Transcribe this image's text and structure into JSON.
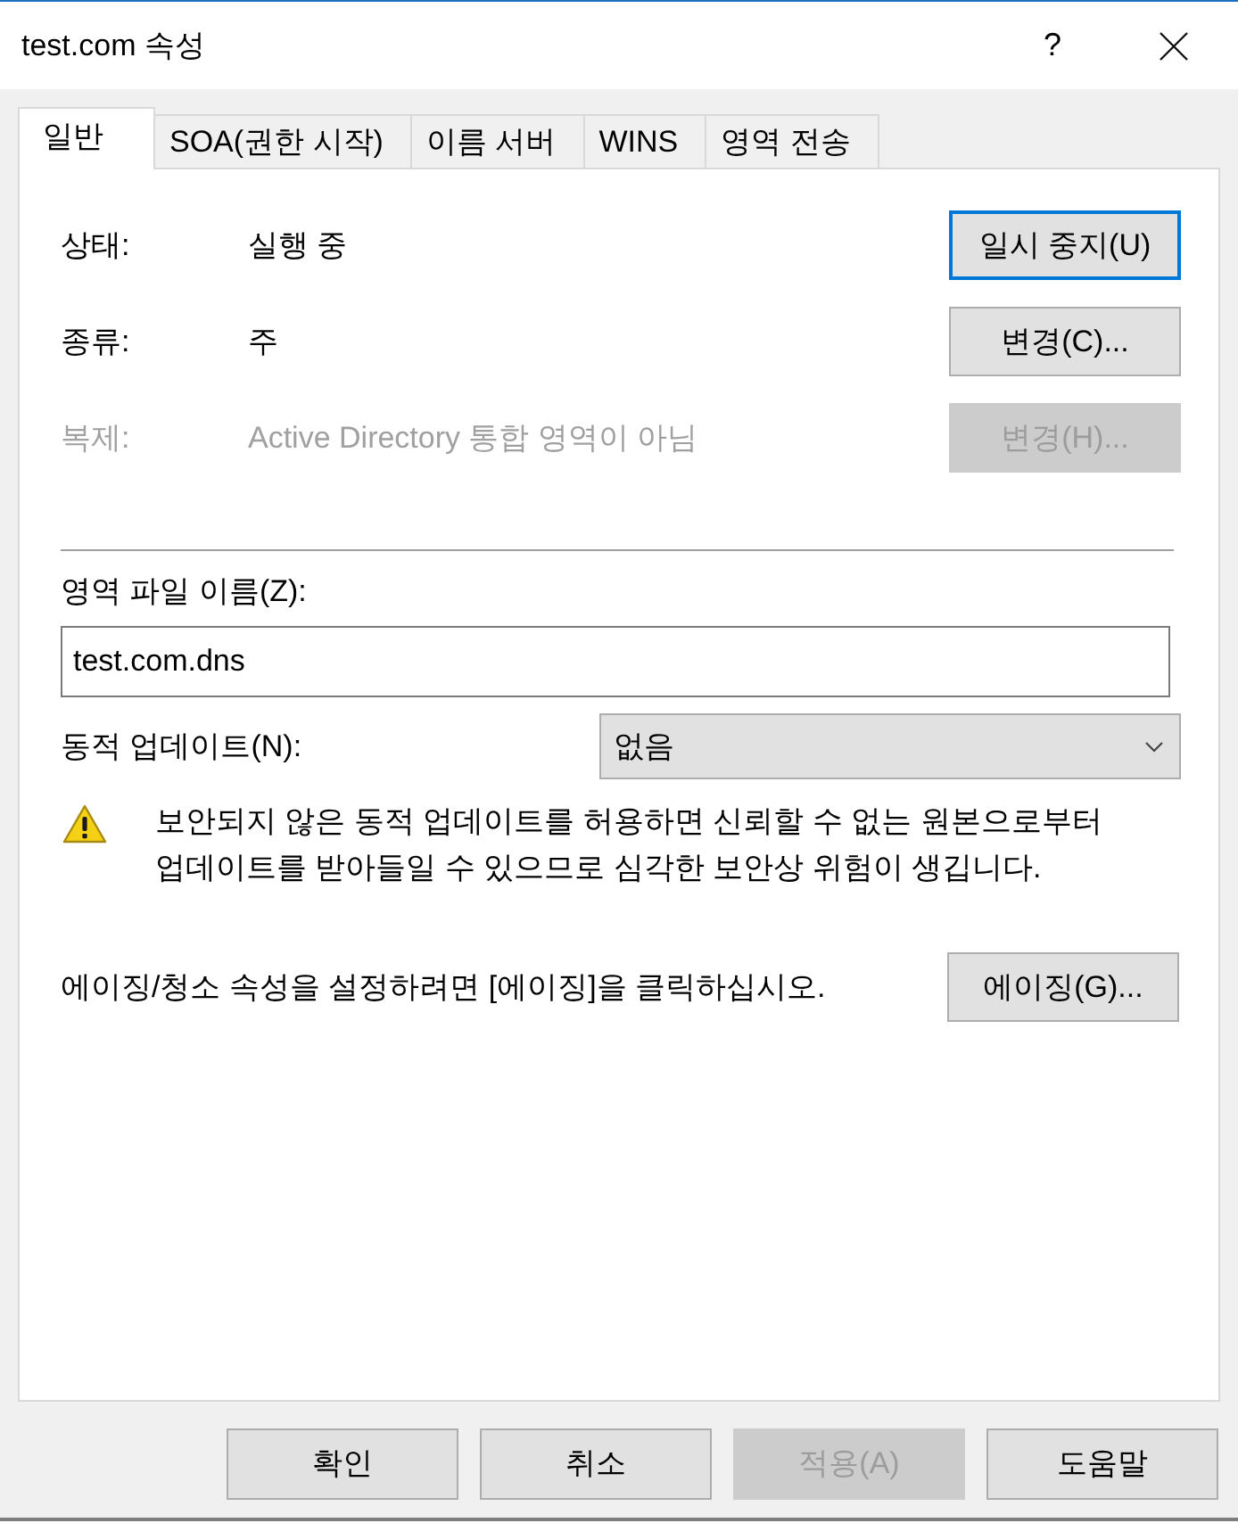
{
  "window": {
    "title": "test.com 속성",
    "help_label": "?"
  },
  "tabs": [
    {
      "label": "일반",
      "selected": true
    },
    {
      "label": "SOA(권한 시작)",
      "selected": false
    },
    {
      "label": "이름 서버",
      "selected": false
    },
    {
      "label": "WINS",
      "selected": false
    },
    {
      "label": "영역 전송",
      "selected": false
    }
  ],
  "general": {
    "properties": [
      {
        "label": "상태:",
        "value": "실행 중",
        "disabled": false,
        "button": {
          "label": "일시 중지(U)",
          "disabled": false,
          "focused": true
        }
      },
      {
        "label": "종류:",
        "value": "주",
        "disabled": false,
        "button": {
          "label": "변경(C)...",
          "disabled": false,
          "focused": false
        }
      },
      {
        "label": "복제:",
        "value": "Active Directory 통합 영역이 아님",
        "disabled": true,
        "button": {
          "label": "변경(H)...",
          "disabled": true,
          "focused": false
        }
      }
    ],
    "zone_file": {
      "label": "영역 파일 이름(Z):",
      "value": "test.com.dns"
    },
    "dynamic_update": {
      "label": "동적 업데이트(N):",
      "value": "없음"
    },
    "warning": "보안되지 않은 동적 업데이트를 허용하면 신뢰할 수 없는 원본으로부터 업데이트를 받아들일 수 있으므로 심각한 보안상 위험이 생깁니다.",
    "aging": {
      "text": "에이징/청소 속성을 설정하려면 [에이징]을 클릭하십시오.",
      "button": {
        "label": "에이징(G)..."
      }
    }
  },
  "buttons": [
    {
      "label": "확인",
      "disabled": false
    },
    {
      "label": "취소",
      "disabled": false
    },
    {
      "label": "적용(A)",
      "disabled": true
    },
    {
      "label": "도움말",
      "disabled": false
    }
  ]
}
